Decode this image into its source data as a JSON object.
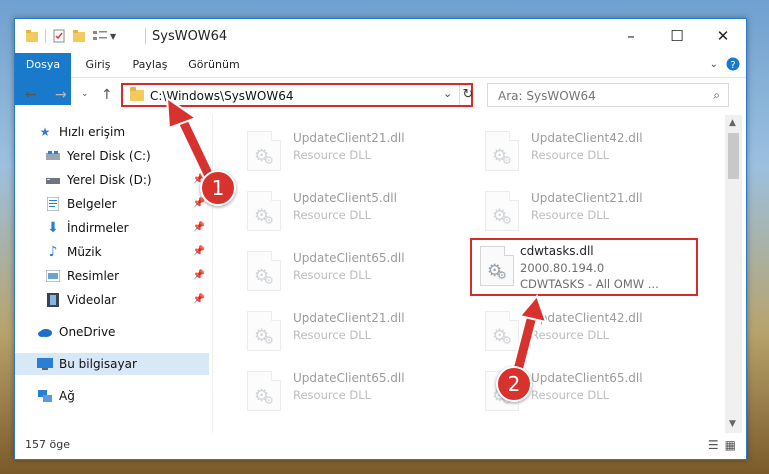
{
  "window": {
    "title": "SysWOW64"
  },
  "title_buttons": {
    "minimize": "–",
    "maximize": "☐",
    "close": "✕"
  },
  "ribbon": {
    "tabs": [
      "Dosya",
      "Giriş",
      "Paylaş",
      "Görünüm"
    ]
  },
  "address": {
    "path": "C:\\Windows\\SysWOW64"
  },
  "search": {
    "placeholder": "Ara: SysWOW64"
  },
  "sidebar": {
    "items": [
      {
        "label": "Hızlı erişim"
      },
      {
        "label": "Yerel Disk (C:)"
      },
      {
        "label": "Yerel Disk (D:)"
      },
      {
        "label": "Belgeler"
      },
      {
        "label": "İndirmeler"
      },
      {
        "label": "Müzik"
      },
      {
        "label": "Resimler"
      },
      {
        "label": "Videolar"
      },
      {
        "label": "OneDrive"
      },
      {
        "label": "Bu bilgisayar"
      },
      {
        "label": "Ağ"
      }
    ]
  },
  "files": [
    {
      "name": "UpdateClient21.dll",
      "desc": "Resource DLL",
      "extra": ""
    },
    {
      "name": "UpdateClient42.dll",
      "desc": "Resource DLL",
      "extra": ""
    },
    {
      "name": "UpdateClient5.dll",
      "desc": "Resource DLL",
      "extra": ""
    },
    {
      "name": "UpdateClient21.dll",
      "desc": "Resource DLL",
      "extra": ""
    },
    {
      "name": "UpdateClient65.dll",
      "desc": "Resource DLL",
      "extra": ""
    },
    {
      "name": "cdwtasks.dll",
      "desc": "2000.80.194.0",
      "extra": "CDWTASKS - All OMW ..."
    },
    {
      "name": "UpdateClient21.dll",
      "desc": "Resource DLL",
      "extra": ""
    },
    {
      "name": "UpdateClient42.dll",
      "desc": "Resource DLL",
      "extra": ""
    },
    {
      "name": "UpdateClient65.dll",
      "desc": "Resource DLL",
      "extra": ""
    },
    {
      "name": "UpdateClient65.dll",
      "desc": "Resource DLL",
      "extra": ""
    }
  ],
  "status": {
    "count": "157 öge"
  },
  "callouts": [
    "1",
    "2"
  ],
  "colors": {
    "accent": "#1979ca",
    "highlight": "#d52b2b"
  }
}
